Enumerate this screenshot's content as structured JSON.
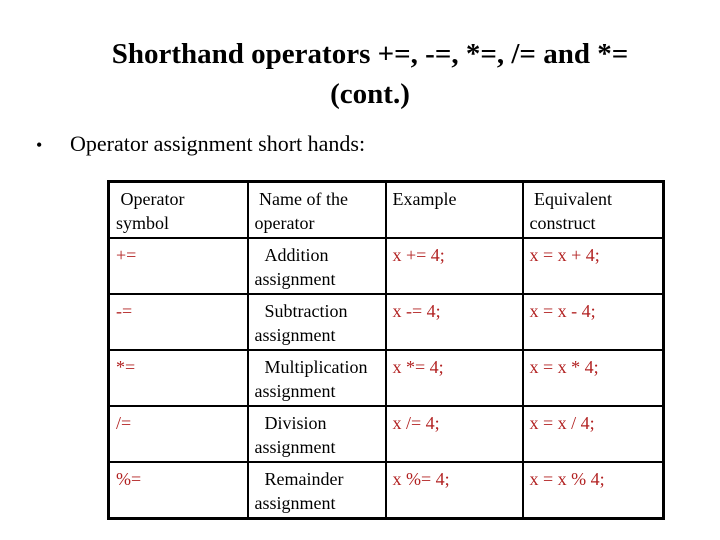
{
  "slide": {
    "title_line1": "Shorthand operators +=, -=, *=, /= and *=",
    "title_line2": "(cont.)",
    "bullet": "Operator assignment short hands:",
    "accent_color": "#b22222"
  },
  "table": {
    "headers": [
      {
        "line1": "Operator",
        "line2": "symbol"
      },
      {
        "line1": "Name of the",
        "line2": "operator"
      },
      {
        "line1": "Example",
        "line2": ""
      },
      {
        "line1": "Equivalent",
        "line2": "construct"
      }
    ],
    "rows": [
      {
        "symbol": "+=",
        "name1": "Addition",
        "name2": "assignment",
        "example": "x += 4;",
        "equivalent": "x = x + 4;"
      },
      {
        "symbol": "-=",
        "name1": "Subtraction",
        "name2": "assignment",
        "example": "x -= 4;",
        "equivalent": "x = x - 4;"
      },
      {
        "symbol": "*=",
        "name1": "Multiplication",
        "name2": "assignment",
        "example": "x *= 4;",
        "equivalent": "x = x * 4;"
      },
      {
        "symbol": "/=",
        "name1": "Division",
        "name2": "assignment",
        "example": "x /= 4;",
        "equivalent": "x = x / 4;"
      },
      {
        "symbol": "%=",
        "name1": "Remainder",
        "name2": "assignment",
        "example": "x %= 4;",
        "equivalent": "x = x % 4;"
      }
    ]
  }
}
